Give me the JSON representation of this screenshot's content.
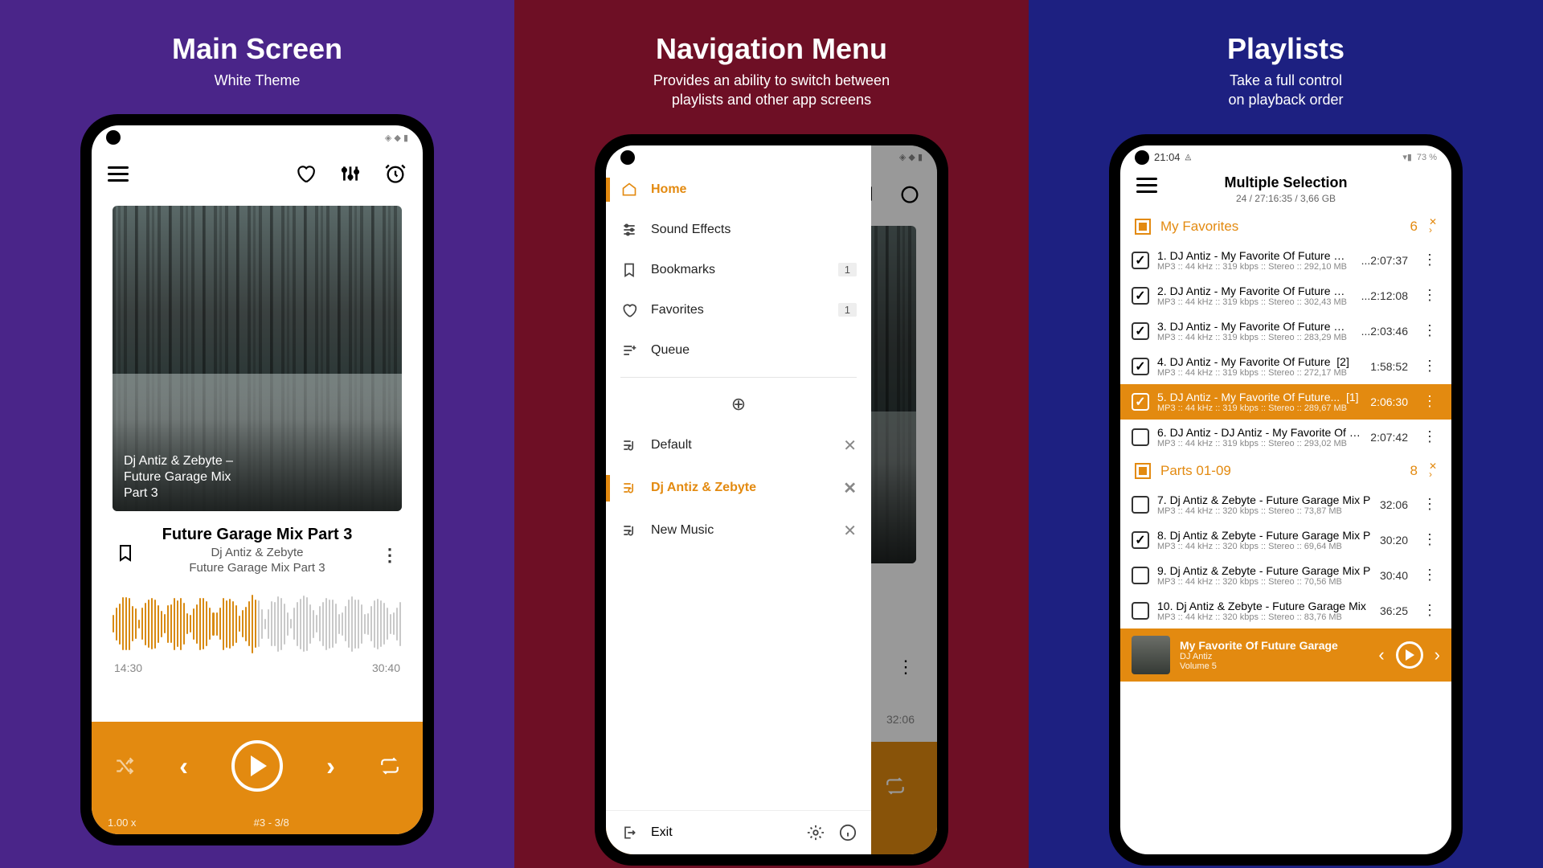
{
  "panels": {
    "main": {
      "title": "Main Screen",
      "subtitle": "White Theme"
    },
    "nav": {
      "title": "Navigation Menu",
      "subtitle": "Provides an ability to switch between\nplaylists and other app screens"
    },
    "pl": {
      "title": "Playlists",
      "subtitle": "Take a full control\non playback order"
    }
  },
  "screen1": {
    "art_caption": "Dj Antiz & Zebyte –\nFuture Garage Mix\nPart 3",
    "title": "Future Garage Mix Part 3",
    "artist": "Dj Antiz & Zebyte",
    "album": "Future Garage Mix Part 3",
    "elapsed": "14:30",
    "total": "30:40",
    "speed": "1.00 x",
    "pos": "#3 - 3/8"
  },
  "screen2": {
    "items": [
      {
        "label": "Home",
        "icon": "home"
      },
      {
        "label": "Sound Effects",
        "icon": "sliders"
      },
      {
        "label": "Bookmarks",
        "icon": "bookmark",
        "badge": "1"
      },
      {
        "label": "Favorites",
        "icon": "heart",
        "badge": "1"
      },
      {
        "label": "Queue",
        "icon": "queue"
      }
    ],
    "playlists": [
      {
        "label": "Default",
        "active": false
      },
      {
        "label": "Dj Antiz & Zebyte",
        "active": true
      },
      {
        "label": "New Music",
        "active": false
      }
    ],
    "exit": "Exit",
    "bg_time": "32:06"
  },
  "screen3": {
    "status_time": "21:04",
    "status_batt": "73 %",
    "title": "Multiple Selection",
    "subtitle": "24 / 27:16:35 / 3,66 GB",
    "sections": [
      {
        "name": "My Favorites",
        "count": "6"
      },
      {
        "name": "Parts 01-09",
        "count": "8"
      }
    ],
    "tracks1": [
      {
        "n": "1",
        "t": "DJ Antiz - My Favorite Of Future Garage",
        "d": "...2:07:37",
        "m": "MP3 :: 44 kHz :: 319 kbps :: Stereo :: 292,10 MB",
        "c": true
      },
      {
        "n": "2",
        "t": "DJ Antiz - My Favorite Of Future Garage",
        "d": "...2:12:08",
        "m": "MP3 :: 44 kHz :: 319 kbps :: Stereo :: 302,43 MB",
        "c": true
      },
      {
        "n": "3",
        "t": "DJ Antiz - My Favorite Of Future Garage",
        "d": "...2:03:46",
        "m": "MP3 :: 44 kHz :: 319 kbps :: Stereo :: 283,29 MB",
        "c": true
      },
      {
        "n": "4",
        "t": "DJ Antiz - My Favorite Of Future",
        "d": "1:58:52",
        "m": "MP3 :: 44 kHz :: 319 kbps :: Stereo :: 272,17 MB",
        "c": true,
        "x": "[2]"
      },
      {
        "n": "5",
        "t": "DJ Antiz - My Favorite Of Future...",
        "d": "2:06:30",
        "m": "MP3 :: 44 kHz :: 319 kbps :: Stereo :: 289,67 MB",
        "c": true,
        "x": "[1]",
        "sel": true
      },
      {
        "n": "6",
        "t": "DJ Antiz - DJ Antiz - My Favorite Of Futu",
        "d": "2:07:42",
        "m": "MP3 :: 44 kHz :: 319 kbps :: Stereo :: 293,02 MB",
        "c": false
      }
    ],
    "tracks2": [
      {
        "n": "7",
        "t": "Dj Antiz & Zebyte - Future Garage Mix P",
        "d": "32:06",
        "m": "MP3 :: 44 kHz :: 320 kbps :: Stereo :: 73,87 MB",
        "c": false
      },
      {
        "n": "8",
        "t": "Dj Antiz & Zebyte - Future Garage Mix P",
        "d": "30:20",
        "m": "MP3 :: 44 kHz :: 320 kbps :: Stereo :: 69,64 MB",
        "c": true
      },
      {
        "n": "9",
        "t": "Dj Antiz & Zebyte - Future Garage Mix P",
        "d": "30:40",
        "m": "MP3 :: 44 kHz :: 320 kbps :: Stereo :: 70,56 MB",
        "c": false
      },
      {
        "n": "10",
        "t": "Dj Antiz & Zebyte - Future Garage Mix",
        "d": "36:25",
        "m": "MP3 :: 44 kHz :: 320 kbps :: Stereo :: 83,76 MB",
        "c": false
      }
    ],
    "mini": {
      "title": "My Favorite Of Future Garage",
      "artist": "DJ Antiz",
      "album": "Volume 5"
    }
  }
}
